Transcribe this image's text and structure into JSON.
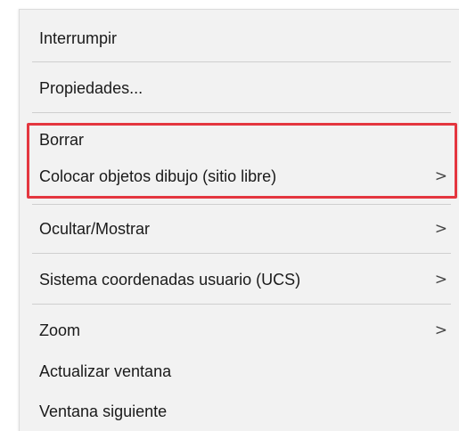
{
  "context_menu": {
    "items": [
      {
        "label": "Interrumpir",
        "has_submenu": false
      },
      {
        "label": "Propiedades...",
        "has_submenu": false
      },
      {
        "label": "Borrar",
        "has_submenu": false
      },
      {
        "label": "Colocar objetos dibujo (sitio libre)",
        "has_submenu": true
      },
      {
        "label": "Ocultar/Mostrar",
        "has_submenu": true
      },
      {
        "label": "Sistema coordenadas usuario (UCS)",
        "has_submenu": true
      },
      {
        "label": "Zoom",
        "has_submenu": true
      },
      {
        "label": "Actualizar ventana",
        "has_submenu": false
      },
      {
        "label": "Ventana siguiente",
        "has_submenu": false
      }
    ],
    "submenu_arrow": ">",
    "highlight_color": "#e4363f"
  }
}
